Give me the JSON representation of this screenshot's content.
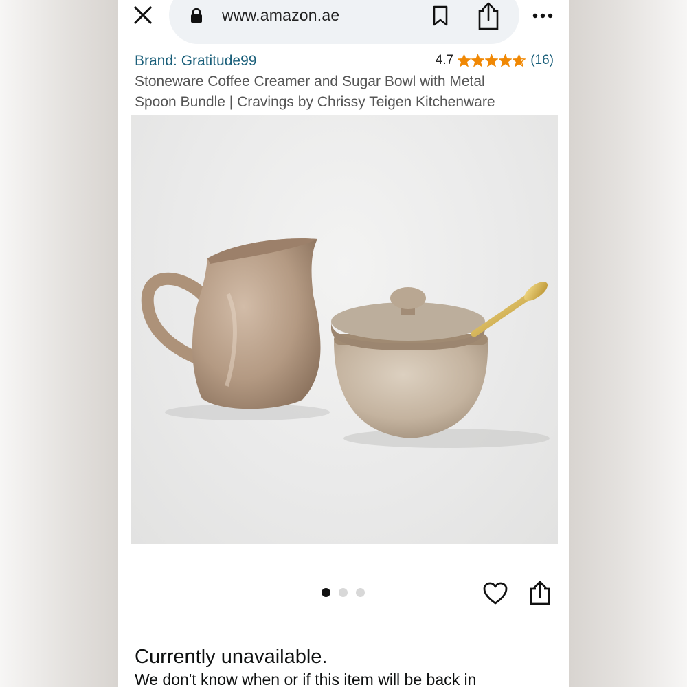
{
  "browser": {
    "url": "www.amazon.ae",
    "close_icon": "close-icon",
    "lock_icon": "lock-icon",
    "bookmark_icon": "bookmark-icon",
    "share_icon": "share-icon",
    "more_icon": "more-icon"
  },
  "product": {
    "brand": "Brand: Gratitude99",
    "rating": "4.7",
    "rating_stars": 4.7,
    "rating_count": "(16)",
    "title_line1": "Stoneware Coffee Creamer and Sugar Bowl with Metal",
    "title_line2": "Spoon Bundle | Cravings by Chrissy Teigen Kitchenware"
  },
  "gallery": {
    "image_count": 3,
    "active_index": 0
  },
  "actions": {
    "wishlist_icon": "heart-icon",
    "share_icon": "share-icon"
  },
  "availability": {
    "status": "Currently unavailable.",
    "description": "We don't know when or if this item will be back in"
  },
  "colors": {
    "link": "#1a5f7a",
    "star": "#f08804",
    "text": "#0f1111"
  }
}
